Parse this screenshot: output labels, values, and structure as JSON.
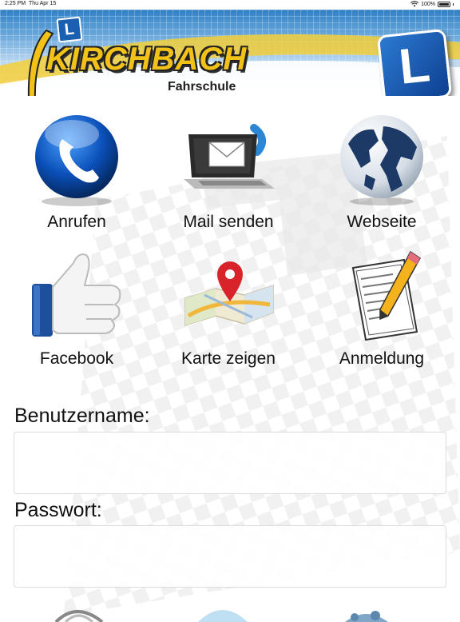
{
  "status_bar": {
    "time": "2:25 PM",
    "date": "Thu Apr 15",
    "battery": "100%"
  },
  "header": {
    "brand": "KIRCHBACH",
    "subtitle": "Fahrschule",
    "badge_letter": "L",
    "small_badge_letter": "L"
  },
  "tiles": [
    {
      "label": "Anrufen",
      "icon": "phone-icon"
    },
    {
      "label": "Mail senden",
      "icon": "mail-laptop-icon"
    },
    {
      "label": "Webseite",
      "icon": "globe-icon"
    },
    {
      "label": "Facebook",
      "icon": "thumbs-up-icon"
    },
    {
      "label": "Karte zeigen",
      "icon": "map-pin-icon"
    },
    {
      "label": "Anmeldung",
      "icon": "document-pencil-icon"
    }
  ],
  "form": {
    "username_label": "Benutzername:",
    "username_value": "",
    "password_label": "Passwort:",
    "password_value": ""
  },
  "colors": {
    "brand_yellow": "#f2c218",
    "brand_blue": "#1a5fb0",
    "header_blue": "#2f7fc4"
  }
}
